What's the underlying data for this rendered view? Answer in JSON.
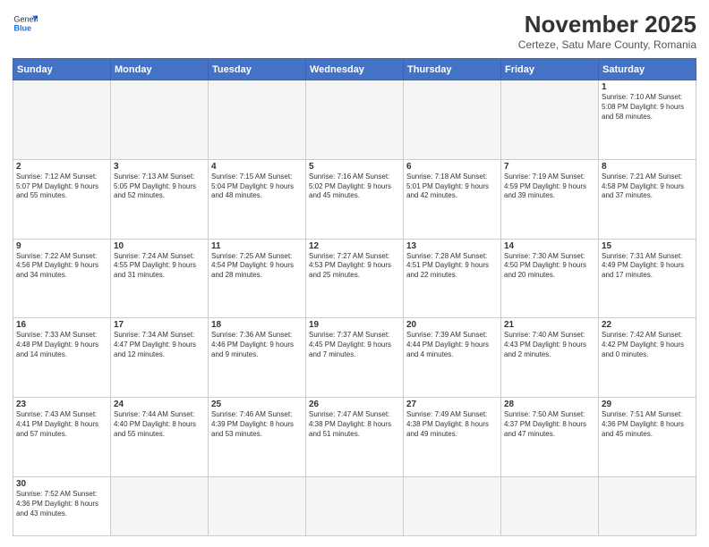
{
  "header": {
    "logo_general": "General",
    "logo_blue": "Blue",
    "month_title": "November 2025",
    "subtitle": "Certeze, Satu Mare County, Romania"
  },
  "days_of_week": [
    "Sunday",
    "Monday",
    "Tuesday",
    "Wednesday",
    "Thursday",
    "Friday",
    "Saturday"
  ],
  "weeks": [
    [
      {
        "day": "",
        "info": ""
      },
      {
        "day": "",
        "info": ""
      },
      {
        "day": "",
        "info": ""
      },
      {
        "day": "",
        "info": ""
      },
      {
        "day": "",
        "info": ""
      },
      {
        "day": "",
        "info": ""
      },
      {
        "day": "1",
        "info": "Sunrise: 7:10 AM\nSunset: 5:08 PM\nDaylight: 9 hours\nand 58 minutes."
      }
    ],
    [
      {
        "day": "2",
        "info": "Sunrise: 7:12 AM\nSunset: 5:07 PM\nDaylight: 9 hours\nand 55 minutes."
      },
      {
        "day": "3",
        "info": "Sunrise: 7:13 AM\nSunset: 5:05 PM\nDaylight: 9 hours\nand 52 minutes."
      },
      {
        "day": "4",
        "info": "Sunrise: 7:15 AM\nSunset: 5:04 PM\nDaylight: 9 hours\nand 48 minutes."
      },
      {
        "day": "5",
        "info": "Sunrise: 7:16 AM\nSunset: 5:02 PM\nDaylight: 9 hours\nand 45 minutes."
      },
      {
        "day": "6",
        "info": "Sunrise: 7:18 AM\nSunset: 5:01 PM\nDaylight: 9 hours\nand 42 minutes."
      },
      {
        "day": "7",
        "info": "Sunrise: 7:19 AM\nSunset: 4:59 PM\nDaylight: 9 hours\nand 39 minutes."
      },
      {
        "day": "8",
        "info": "Sunrise: 7:21 AM\nSunset: 4:58 PM\nDaylight: 9 hours\nand 37 minutes."
      }
    ],
    [
      {
        "day": "9",
        "info": "Sunrise: 7:22 AM\nSunset: 4:56 PM\nDaylight: 9 hours\nand 34 minutes."
      },
      {
        "day": "10",
        "info": "Sunrise: 7:24 AM\nSunset: 4:55 PM\nDaylight: 9 hours\nand 31 minutes."
      },
      {
        "day": "11",
        "info": "Sunrise: 7:25 AM\nSunset: 4:54 PM\nDaylight: 9 hours\nand 28 minutes."
      },
      {
        "day": "12",
        "info": "Sunrise: 7:27 AM\nSunset: 4:53 PM\nDaylight: 9 hours\nand 25 minutes."
      },
      {
        "day": "13",
        "info": "Sunrise: 7:28 AM\nSunset: 4:51 PM\nDaylight: 9 hours\nand 22 minutes."
      },
      {
        "day": "14",
        "info": "Sunrise: 7:30 AM\nSunset: 4:50 PM\nDaylight: 9 hours\nand 20 minutes."
      },
      {
        "day": "15",
        "info": "Sunrise: 7:31 AM\nSunset: 4:49 PM\nDaylight: 9 hours\nand 17 minutes."
      }
    ],
    [
      {
        "day": "16",
        "info": "Sunrise: 7:33 AM\nSunset: 4:48 PM\nDaylight: 9 hours\nand 14 minutes."
      },
      {
        "day": "17",
        "info": "Sunrise: 7:34 AM\nSunset: 4:47 PM\nDaylight: 9 hours\nand 12 minutes."
      },
      {
        "day": "18",
        "info": "Sunrise: 7:36 AM\nSunset: 4:46 PM\nDaylight: 9 hours\nand 9 minutes."
      },
      {
        "day": "19",
        "info": "Sunrise: 7:37 AM\nSunset: 4:45 PM\nDaylight: 9 hours\nand 7 minutes."
      },
      {
        "day": "20",
        "info": "Sunrise: 7:39 AM\nSunset: 4:44 PM\nDaylight: 9 hours\nand 4 minutes."
      },
      {
        "day": "21",
        "info": "Sunrise: 7:40 AM\nSunset: 4:43 PM\nDaylight: 9 hours\nand 2 minutes."
      },
      {
        "day": "22",
        "info": "Sunrise: 7:42 AM\nSunset: 4:42 PM\nDaylight: 9 hours\nand 0 minutes."
      }
    ],
    [
      {
        "day": "23",
        "info": "Sunrise: 7:43 AM\nSunset: 4:41 PM\nDaylight: 8 hours\nand 57 minutes."
      },
      {
        "day": "24",
        "info": "Sunrise: 7:44 AM\nSunset: 4:40 PM\nDaylight: 8 hours\nand 55 minutes."
      },
      {
        "day": "25",
        "info": "Sunrise: 7:46 AM\nSunset: 4:39 PM\nDaylight: 8 hours\nand 53 minutes."
      },
      {
        "day": "26",
        "info": "Sunrise: 7:47 AM\nSunset: 4:38 PM\nDaylight: 8 hours\nand 51 minutes."
      },
      {
        "day": "27",
        "info": "Sunrise: 7:49 AM\nSunset: 4:38 PM\nDaylight: 8 hours\nand 49 minutes."
      },
      {
        "day": "28",
        "info": "Sunrise: 7:50 AM\nSunset: 4:37 PM\nDaylight: 8 hours\nand 47 minutes."
      },
      {
        "day": "29",
        "info": "Sunrise: 7:51 AM\nSunset: 4:36 PM\nDaylight: 8 hours\nand 45 minutes."
      }
    ],
    [
      {
        "day": "30",
        "info": "Sunrise: 7:52 AM\nSunset: 4:36 PM\nDaylight: 8 hours\nand 43 minutes."
      },
      {
        "day": "",
        "info": ""
      },
      {
        "day": "",
        "info": ""
      },
      {
        "day": "",
        "info": ""
      },
      {
        "day": "",
        "info": ""
      },
      {
        "day": "",
        "info": ""
      },
      {
        "day": "",
        "info": ""
      }
    ]
  ]
}
